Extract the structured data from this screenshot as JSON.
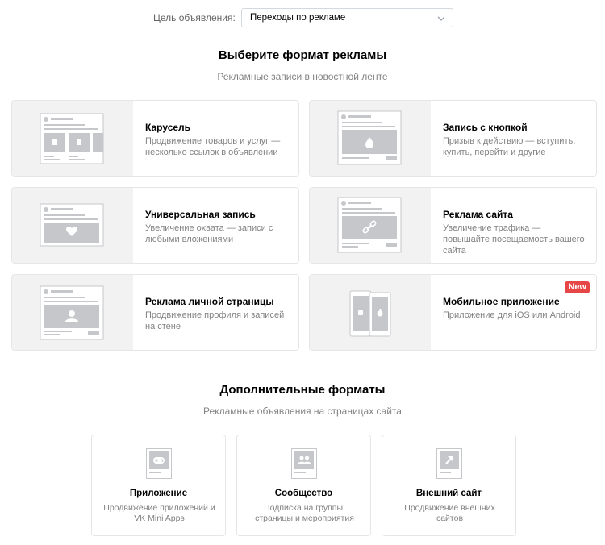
{
  "goal": {
    "label": "Цель объявления:",
    "value": "Переходы по рекламе"
  },
  "feed_section": {
    "title": "Выберите формат рекламы",
    "subtitle": "Рекламные записи в новостной ленте"
  },
  "formats": [
    {
      "title": "Карусель",
      "desc": "Продвижение товаров и услуг — несколько ссылок в объявлении",
      "icon": "carousel-preview-icon"
    },
    {
      "title": "Запись с кнопкой",
      "desc": "Призыв к действию — вступить, купить, перейти и другие",
      "icon": "button-post-preview-icon"
    },
    {
      "title": "Универсальная запись",
      "desc": "Увеличение охвата — записи с любыми вложениями",
      "icon": "universal-post-preview-icon"
    },
    {
      "title": "Реклама сайта",
      "desc": "Увеличение трафика — повышайте посещаемость вашего сайта",
      "icon": "site-ad-preview-icon"
    },
    {
      "title": "Реклама личной страницы",
      "desc": "Продвижение профиля и записей на стене",
      "icon": "personal-page-preview-icon"
    },
    {
      "title": "Мобильное приложение",
      "desc": "Приложение для iOS или Android",
      "icon": "mobile-app-preview-icon",
      "badge": "New"
    }
  ],
  "extra_section": {
    "title": "Дополнительные форматы",
    "subtitle": "Рекламные объявления на страницах сайта"
  },
  "extra_formats": [
    {
      "title": "Приложение",
      "desc": "Продвижение приложений и VK Mini Apps",
      "icon": "gamepad-icon"
    },
    {
      "title": "Сообщество",
      "desc": "Подписка на группы, страницы и мероприятия",
      "icon": "community-icon"
    },
    {
      "title": "Внешний сайт",
      "desc": "Продвижение внешних сайтов",
      "icon": "external-link-icon"
    }
  ],
  "colors": {
    "border": "#e4e6e9",
    "thumb_bg": "#f2f2f2",
    "placeholder": "#c5c7ca",
    "badge": "#e64646",
    "muted_text": "#828282"
  }
}
